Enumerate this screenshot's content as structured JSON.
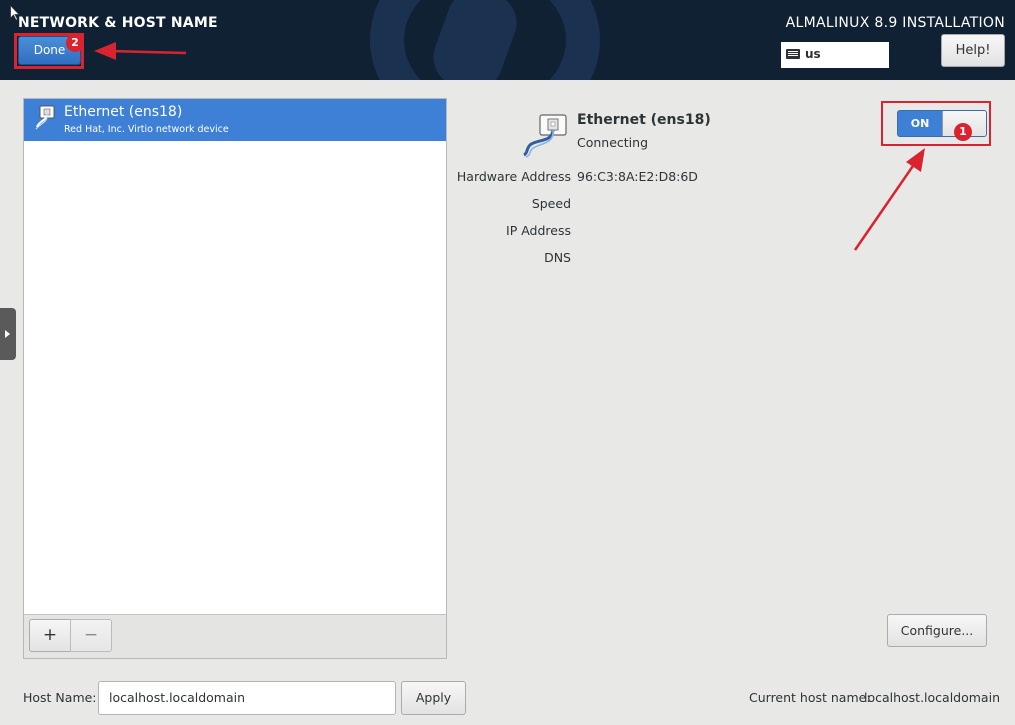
{
  "header": {
    "spoke_title": "NETWORK & HOST NAME",
    "done_label": "Done",
    "product_title": "ALMALINUX 8.9 INSTALLATION",
    "keyboard_layout": "us",
    "help_label": "Help!"
  },
  "device_list": {
    "items": [
      {
        "name": "Ethernet (ens18)",
        "description": "Red Hat, Inc. Virtio network device",
        "selected": true
      }
    ],
    "add_label": "+",
    "remove_label": "−"
  },
  "details": {
    "name": "Ethernet (ens18)",
    "status": "Connecting",
    "rows": [
      {
        "label": "Hardware Address",
        "value": "96:C3:8A:E2:D8:6D"
      },
      {
        "label": "Speed",
        "value": ""
      },
      {
        "label": "IP Address",
        "value": ""
      },
      {
        "label": "DNS",
        "value": ""
      }
    ],
    "toggle_label": "ON",
    "toggle_state": true,
    "configure_label": "Configure..."
  },
  "hostname": {
    "label": "Host Name:",
    "value": "localhost.localdomain",
    "apply_label": "Apply",
    "current_label": "Current host name:",
    "current_value": "localhost.localdomain"
  },
  "annotations": {
    "step1": "1",
    "step2": "2",
    "color": "#d9232e"
  },
  "colors": {
    "header_bg": "#0f2133",
    "accent": "#3d80d6",
    "background": "#e8e8e7"
  }
}
